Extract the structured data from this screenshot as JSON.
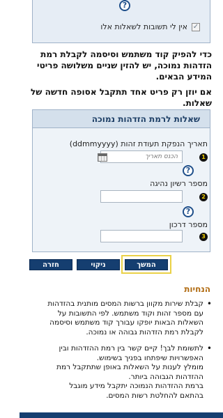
{
  "top_panel": {
    "checkbox_label": "אין לי תשובות לשאלות אלו",
    "checkbox_checked": true
  },
  "intro": {
    "paragraph1": "כדי להפיק קוד משתמש וסיסמה לקבלת רמת הזדהות נמוכה, יש להזין שניים משלושה פריטי המידע הבאים.",
    "paragraph2": "אם יוזן רק פריט אחד תתקבל אסופה חדשה של שאלות."
  },
  "form": {
    "title": "שאלות לרמת הזדהות נמוכה",
    "fields": [
      {
        "number": "1",
        "label": "תאריך הנפקת תעודת זהות (ddmmyyyy)",
        "placeholder": "הכנס תאריך",
        "value": ""
      },
      {
        "number": "2",
        "label": "מספר רשיון נהיגה",
        "placeholder": "",
        "value": ""
      },
      {
        "number": "3",
        "label": "מספר דרכון",
        "placeholder": "",
        "value": ""
      }
    ]
  },
  "buttons": {
    "continue": "המשך",
    "clear": "ניקוי",
    "back": "חזרה"
  },
  "guide": {
    "title": "הנחיות",
    "items": [
      {
        "lines": [
          "קבלת שירות מקוון ברשות המסים מותנית בהזדהות",
          "עם מספר זהות וקוד משתמש. לפי התשובות על",
          "השאלות הבאות יופקו עבורך קוד משתמש וסיסמה",
          "לקבלת רמת הזדהות גבוהה או נמוכה."
        ]
      },
      {
        "lines": [
          "לתשומת לבך! קיים קשר בין רמת ההזדהות ובין",
          "האפשרויות שיפתחו בפניך בשימוש.",
          "מומלץ לענות על השאלות באופן שתתקבל רמת",
          "ההזדהות הגבוהה ביותר.",
          "ברמת ההזדהות הנמוכה יתקבל מידע מוגבל",
          "בהתאם להחלטת רשות המסים."
        ]
      }
    ]
  },
  "colors": {
    "primary": "#153e70",
    "highlight": "#ead146",
    "guide_title": "#b06a10",
    "panel_bg": "#eef3f8"
  }
}
